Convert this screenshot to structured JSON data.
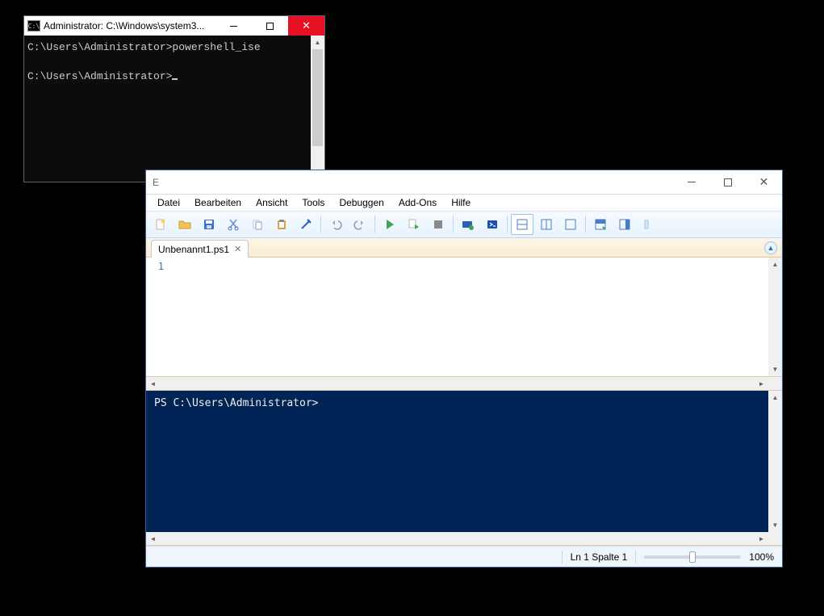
{
  "cmd": {
    "title": "Administrator: C:\\Windows\\system3...",
    "icon_label": "C:\\",
    "lines": [
      "C:\\Users\\Administrator>powershell_ise",
      "",
      "C:\\Users\\Administrator>"
    ]
  },
  "ise": {
    "title_suffix": "E",
    "menu": [
      "Datei",
      "Bearbeiten",
      "Ansicht",
      "Tools",
      "Debuggen",
      "Add-Ons",
      "Hilfe"
    ],
    "toolbar_names": [
      "new-file",
      "open-file",
      "save-file",
      "cut",
      "copy",
      "paste",
      "clear",
      "sep",
      "undo",
      "redo",
      "sep",
      "run-script",
      "run-selection",
      "stop",
      "sep",
      "remote-powershell",
      "powershell",
      "sep",
      "layout-split-h",
      "layout-split-v",
      "layout-full",
      "sep",
      "show-script",
      "show-command",
      "pane-toggle"
    ],
    "tab": {
      "label": "Unbenannt1.ps1"
    },
    "editor": {
      "gutter": [
        "1"
      ],
      "content": ""
    },
    "console_prompt": "PS C:\\Users\\Administrator>",
    "status": {
      "pos": "Ln 1 Spalte 1",
      "zoom": "100%"
    }
  }
}
